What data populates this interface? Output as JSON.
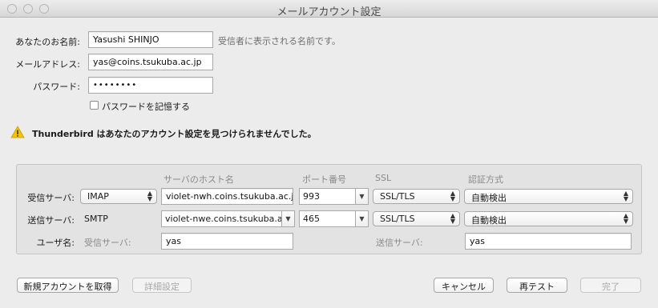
{
  "window": {
    "title": "メールアカウント設定"
  },
  "identity": {
    "name_label": "あなたのお名前:",
    "name_value": "Yasushi SHINJO",
    "name_hint": "受信者に表示される名前です。",
    "email_label": "メールアドレス:",
    "email_value": "yas@coins.tsukuba.ac.jp",
    "password_label": "パスワード:",
    "password_value": "••••••••",
    "remember_label": "パスワードを記憶する",
    "remember_checked": false
  },
  "warning": {
    "icon": "warning-icon",
    "text": "Thunderbird はあなたのアカウント設定を見つけられませんでした。"
  },
  "server_table": {
    "headers": {
      "hostname": "サーバのホスト名",
      "port": "ポート番号",
      "ssl": "SSL",
      "auth": "認証方式"
    },
    "incoming": {
      "label": "受信サーバ:",
      "protocol": "IMAP",
      "hostname": "violet-nwh.coins.tsukuba.ac.jp",
      "port": "993",
      "ssl": "SSL/TLS",
      "auth": "自動検出"
    },
    "outgoing": {
      "label": "送信サーバ:",
      "protocol": "SMTP",
      "hostname": "violet-nwe.coins.tsukuba.ac.jp",
      "port": "465",
      "ssl": "SSL/TLS",
      "auth": "自動検出"
    },
    "username": {
      "label": "ユーザ名:",
      "incoming_label": "受信サーバ:",
      "incoming_value": "yas",
      "outgoing_label": "送信サーバ:",
      "outgoing_value": "yas"
    }
  },
  "buttons": {
    "new_account": "新規アカウントを取得",
    "advanced": "詳細設定",
    "cancel": "キャンセル",
    "retest": "再テスト",
    "done": "完了"
  }
}
